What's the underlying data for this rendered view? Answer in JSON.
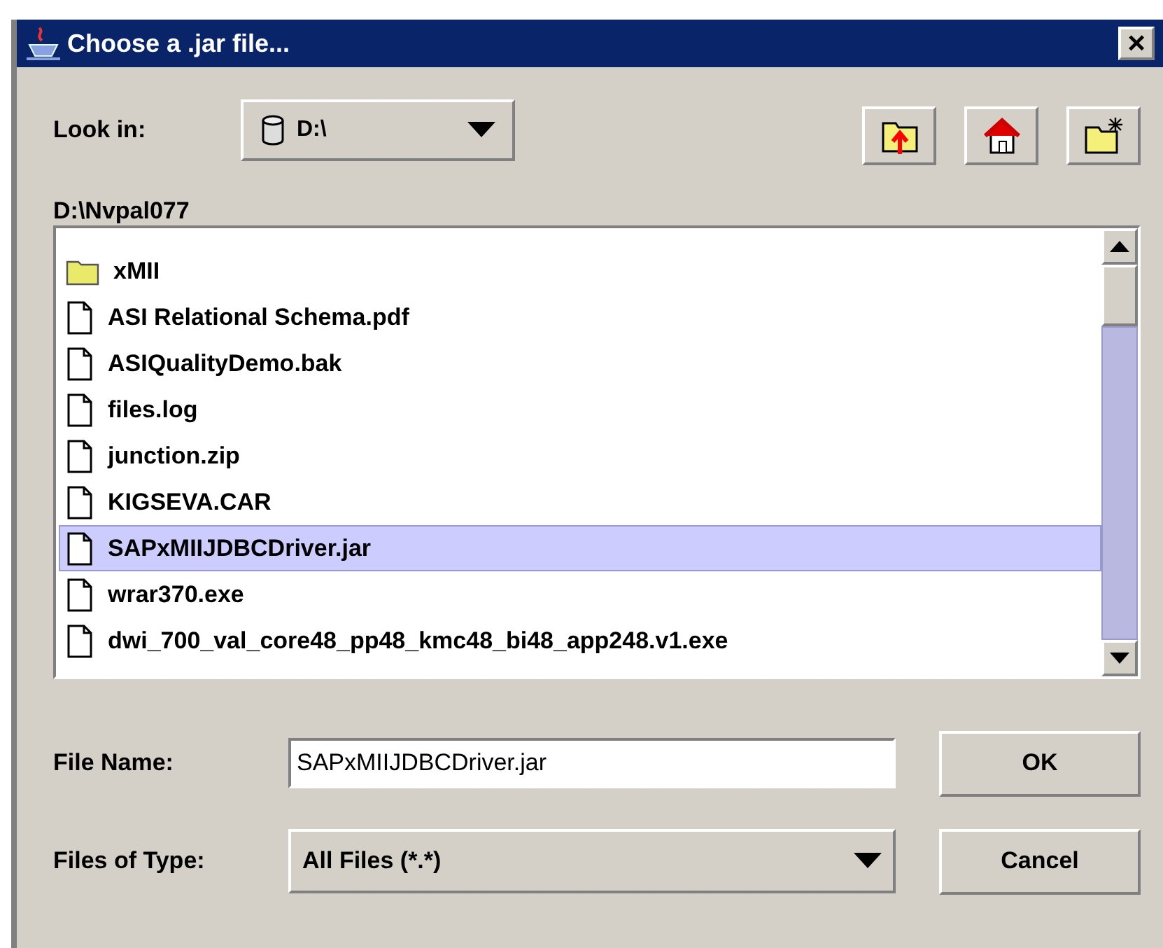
{
  "window": {
    "title": "Choose a .jar file...",
    "close": "×"
  },
  "look_in": {
    "label": "Look in:",
    "value": "D:\\"
  },
  "toolbar": [
    {
      "kind": "up"
    },
    {
      "kind": "home"
    },
    {
      "kind": "new"
    }
  ],
  "path": "D:\\Nvpal077",
  "files": [
    {
      "name": "xMII",
      "kind": "folder",
      "selected": false
    },
    {
      "name": "ASI Relational Schema.pdf",
      "kind": "file",
      "selected": false
    },
    {
      "name": "ASIQualityDemo.bak",
      "kind": "file",
      "selected": false
    },
    {
      "name": "files.log",
      "kind": "file",
      "selected": false
    },
    {
      "name": "junction.zip",
      "kind": "file",
      "selected": false
    },
    {
      "name": "KIGSEVA.CAR",
      "kind": "file",
      "selected": false
    },
    {
      "name": "SAPxMIIJDBCDriver.jar",
      "kind": "file",
      "selected": true
    },
    {
      "name": "wrar370.exe",
      "kind": "file",
      "selected": false
    },
    {
      "name": "dwi_700_val_core48_pp48_kmc48_bi48_app248.v1.exe",
      "kind": "file",
      "selected": false
    }
  ],
  "file_name": {
    "label": "File Name:",
    "value": "SAPxMIIJDBCDriver.jar"
  },
  "files_of_type": {
    "label": "Files of Type:",
    "value": "All Files (*.*)"
  },
  "buttons": [
    "OK",
    "Cancel"
  ]
}
